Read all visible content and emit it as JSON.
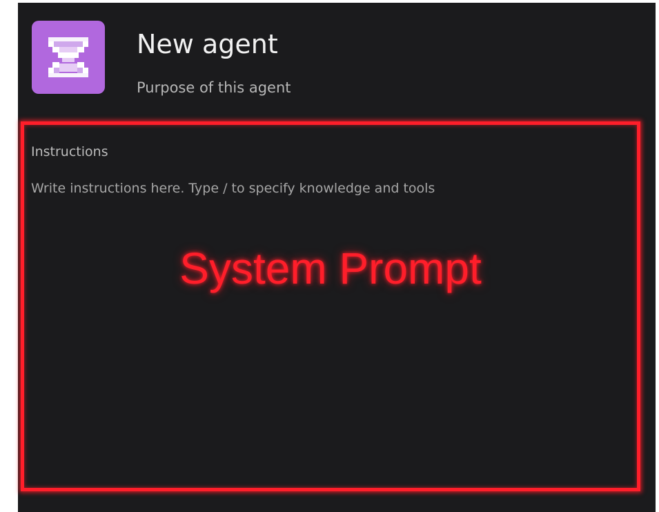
{
  "agent": {
    "name": "New agent",
    "purpose": "Purpose of this agent",
    "avatar_icon": "pixel-hourglass-icon",
    "avatar_color": "#b168de"
  },
  "instructions": {
    "label": "Instructions",
    "placeholder": "Write instructions here. Type / to specify knowledge and tools"
  },
  "annotation": {
    "label": "System Prompt",
    "color": "#ff1e2a"
  }
}
